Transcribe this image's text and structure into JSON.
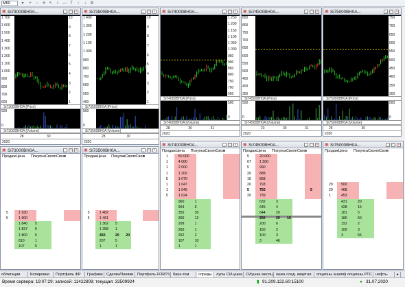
{
  "toolbar": {
    "timeframe": "M60"
  },
  "tabs": [
    "облигации",
    "Копировки",
    "Портфель ФР",
    "Графики",
    "Сделки/Заявки",
    "Портфель FORTS",
    "банк-том",
    "спреды",
    "лупы СИ-ушка",
    "СИушка месяц",
    "ошка след. квартал.",
    "опционы анализ",
    "опционы РТС",
    "нефть-"
  ],
  "active_tab": 7,
  "status": {
    "server": "Время сервера: 19:07:29; записей: 11422808; текущая: 33509924",
    "ip": "91.209.122.60:15100",
    "date": "31.07.2020"
  },
  "charts": [
    {
      "title": "Si73000BH0A...",
      "price_label": "Si73000BH0A [Price]",
      "volume_label": "Si73000BH0A [Volume]",
      "left_ticks": [
        "1 700",
        "1 600",
        "1 500",
        "1 400",
        "1 300",
        "1 200",
        "1 100",
        "1 000",
        "900",
        "800",
        "700",
        "600"
      ],
      "right_ticks": [
        "10",
        "9",
        "8",
        "7",
        "6",
        "5",
        "4",
        "3",
        "2",
        "1"
      ],
      "vol_ticks": [
        "500",
        "0"
      ],
      "dates": [
        "28",
        "30"
      ],
      "year": "2020",
      "seed": 3
    },
    {
      "title": "Si73500BH0A...",
      "price_label": "Si73500BH0A [Price]",
      "volume_label": "Si73500BH0A [Volume]",
      "left_ticks": [
        "1 400",
        "1 300",
        "1 200",
        "1 100",
        "1 000",
        "900",
        "800",
        "700",
        "600",
        "500",
        "400"
      ],
      "right_ticks": [
        "10",
        "9",
        "8",
        "7",
        "6",
        "5",
        "4",
        "3",
        "2",
        "1"
      ],
      "vol_ticks": [
        "500",
        "0"
      ],
      "dates": [
        "28",
        "30"
      ],
      "year": "2020",
      "seed": 7
    },
    {
      "title": "Si74000BH0A...",
      "price_label": "Si74000BH0A [Price]",
      "volume_label": "Si74000BH0A [Volume]",
      "left_ticks": [],
      "right_ticks": [
        "1 250",
        "1 200",
        "1 150",
        "1 100",
        "1 050",
        "1 000",
        "950",
        "900",
        "850",
        "800",
        "750",
        "700",
        "650"
      ],
      "vol_ticks": [
        "500",
        "0"
      ],
      "dates": [
        "28",
        "30",
        "31"
      ],
      "year": "2020",
      "seed": 11
    },
    {
      "title": "Si74500BH0A...",
      "price_label": "Si74500BH0A [Price]",
      "volume_label": "Si74500BH0A [Volume]",
      "left_ticks": [
        "850",
        "800",
        "750",
        "700",
        "650",
        "600",
        "550",
        "500",
        "450",
        "400",
        "350"
      ],
      "right_ticks": [],
      "vol_ticks": [
        "500",
        "0"
      ],
      "dates": [
        "23",
        "30",
        "31"
      ],
      "year": "2020",
      "seed": 5
    },
    {
      "title": "Si75000BH0A...",
      "price_label": "Si75000BH0A [Price]",
      "volume_label": "Si75000BH0A [Volume]",
      "left_ticks": [],
      "right_ticks": [
        "750",
        "700",
        "650",
        "600",
        "550",
        "500",
        "450",
        "400",
        "350",
        "300"
      ],
      "vol_ticks": [
        "500",
        "0"
      ],
      "dates": [
        "28",
        "30"
      ],
      "year": "2020",
      "seed": 9
    }
  ],
  "book_header": [
    "Продаж",
    "Цена",
    "Покупк",
    "аСвоя",
    "пСвоя",
    "п"
  ],
  "books": [
    {
      "title": "Si73000BH0A...",
      "asks": [
        {
          "sell": "5",
          "price": "1 930"
        },
        {
          "sell": "5",
          "price": "1 900"
        }
      ],
      "bids": [
        {
          "price": "1 840",
          "buy": "5"
        },
        {
          "price": "1 837",
          "buy": "5"
        },
        {
          "price": "1 800",
          "buy": "5"
        },
        {
          "price": "810",
          "buy": "1"
        },
        {
          "price": "107",
          "buy": "5"
        }
      ]
    },
    {
      "title": "Si73500BH0A...",
      "asks": [
        {
          "sell": "5",
          "price": "1 482"
        },
        {
          "sell": "5",
          "price": "1 461"
        }
      ],
      "bids": [
        {
          "price": "1 362",
          "buy": "5"
        },
        {
          "price": "1 358",
          "buy": "1"
        },
        {
          "price": "450",
          "buy": "20",
          "own": "20",
          "bold": true
        },
        {
          "price": "207",
          "buy": "5"
        },
        {
          "price": "1",
          "buy": "1"
        }
      ]
    },
    {
      "title": "Si74000BH0A...",
      "asks": [
        {
          "sell": "1",
          "price": "50 000"
        },
        {
          "sell": "1",
          "price": "4 000"
        },
        {
          "sell": "1",
          "price": "2 000"
        },
        {
          "sell": "1",
          "price": "1 200"
        },
        {
          "sell": "5",
          "price": "1 070"
        },
        {
          "sell": "1",
          "price": "1 047"
        },
        {
          "sell": "1",
          "price": "1 045"
        },
        {
          "sell": "5",
          "price": "1 024"
        }
      ],
      "bids": [
        {
          "price": "960",
          "buy": "1"
        },
        {
          "price": "954",
          "buy": "5"
        },
        {
          "price": "355",
          "buy": "30"
        },
        {
          "price": "300",
          "buy": "12"
        },
        {
          "price": "299",
          "buy": "1"
        },
        {
          "price": "260",
          "buy": "1"
        },
        {
          "price": "252",
          "buy": "2"
        },
        {
          "price": "107",
          "buy": "10"
        },
        {
          "price": "1",
          "buy": "1"
        }
      ]
    },
    {
      "title": "Si74500BH0A...",
      "asks": [
        {
          "sell": "5",
          "price": "20 000"
        },
        {
          "sell": "67",
          "price": "1 500"
        },
        {
          "sell": "5",
          "price": "990"
        },
        {
          "sell": "20",
          "price": "888"
        },
        {
          "sell": "10",
          "price": "858"
        },
        {
          "sell": "20",
          "price": "793"
        },
        {
          "sell": "5",
          "price": "750",
          "own": "5",
          "bold": true
        },
        {
          "sell": "20",
          "price": "739"
        }
      ],
      "bids": [
        {
          "price": "632",
          "buy": "3"
        },
        {
          "price": "645",
          "buy": "4"
        },
        {
          "price": "644",
          "buy": "20"
        },
        {
          "price": "250",
          "buy": "20",
          "own": "10",
          "bold": true
        },
        {
          "price": "200",
          "buy": "6"
        },
        {
          "price": "150",
          "buy": "2"
        },
        {
          "price": "100",
          "buy": "3"
        },
        {
          "price": "3",
          "buy": "46"
        }
      ]
    },
    {
      "title": "Si75000BH0A...",
      "asks": [
        {
          "sell": "29",
          "price": "500"
        },
        {
          "sell": "20",
          "price": "468"
        },
        {
          "sell": "1",
          "price": "453"
        }
      ],
      "bids": [
        {
          "price": "431",
          "buy": "20"
        },
        {
          "price": "428",
          "buy": "15"
        },
        {
          "price": "181",
          "buy": "5"
        },
        {
          "price": "180",
          "buy": "60"
        },
        {
          "price": "110",
          "buy": "2"
        },
        {
          "price": "100",
          "buy": "3"
        },
        {
          "price": "3",
          "buy": "55"
        }
      ]
    }
  ]
}
